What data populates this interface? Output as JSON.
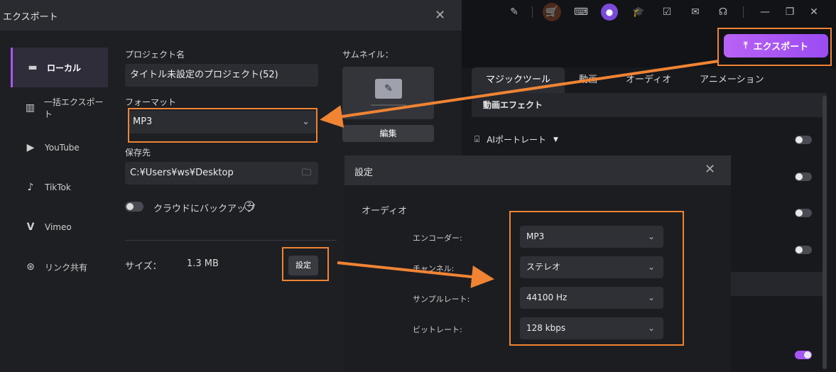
{
  "app": {
    "top_icons": [
      "edit-icon",
      "cart-icon",
      "keyboard-icon",
      "avatar-icon",
      "graduation-icon",
      "settings-task-icon",
      "mail-icon",
      "headset-icon",
      "minimize-icon",
      "restore-icon",
      "close-icon"
    ],
    "export_button": "エクスポート",
    "tabs": [
      "マジックツール",
      "動画",
      "オーディオ",
      "アニメーション"
    ],
    "section_title": "動画エフェクト",
    "ai_portrait": "AIポートレート"
  },
  "export_dialog": {
    "title": "エクスポート",
    "nav": [
      {
        "label": "ローカル",
        "icon": "local-icon"
      },
      {
        "label": "一括エクスポート",
        "icon": "batch-export-icon"
      },
      {
        "label": "YouTube",
        "icon": "youtube-icon"
      },
      {
        "label": "TikTok",
        "icon": "tiktok-icon"
      },
      {
        "label": "Vimeo",
        "icon": "vimeo-icon"
      },
      {
        "label": "リンク共有",
        "icon": "share-link-icon"
      }
    ],
    "project_name_label": "プロジェクト名",
    "project_name": "タイトル未設定のプロジェクト(52)",
    "format_label": "フォーマット",
    "format_value": "MP3",
    "save_location_label": "保存先",
    "save_location": "C:¥Users¥ws¥Desktop",
    "cloud_backup_label": "クラウドにバックアップ",
    "size_label": "サイズ：",
    "size_value": "1.3 MB",
    "settings_button": "設定",
    "thumbnail_label": "サムネイル：",
    "edit_button": "編集"
  },
  "settings_dialog": {
    "title": "設定",
    "section": "オーディオ",
    "rows": [
      {
        "label": "エンコーダー:",
        "value": "MP3"
      },
      {
        "label": "チャンネル:",
        "value": "ステレオ"
      },
      {
        "label": "サンプルレート:",
        "value": "44100 Hz"
      },
      {
        "label": "ビットレート:",
        "value": "128 kbps"
      }
    ]
  },
  "colors": {
    "accent": "#a855f7",
    "highlight": "#f08433"
  }
}
